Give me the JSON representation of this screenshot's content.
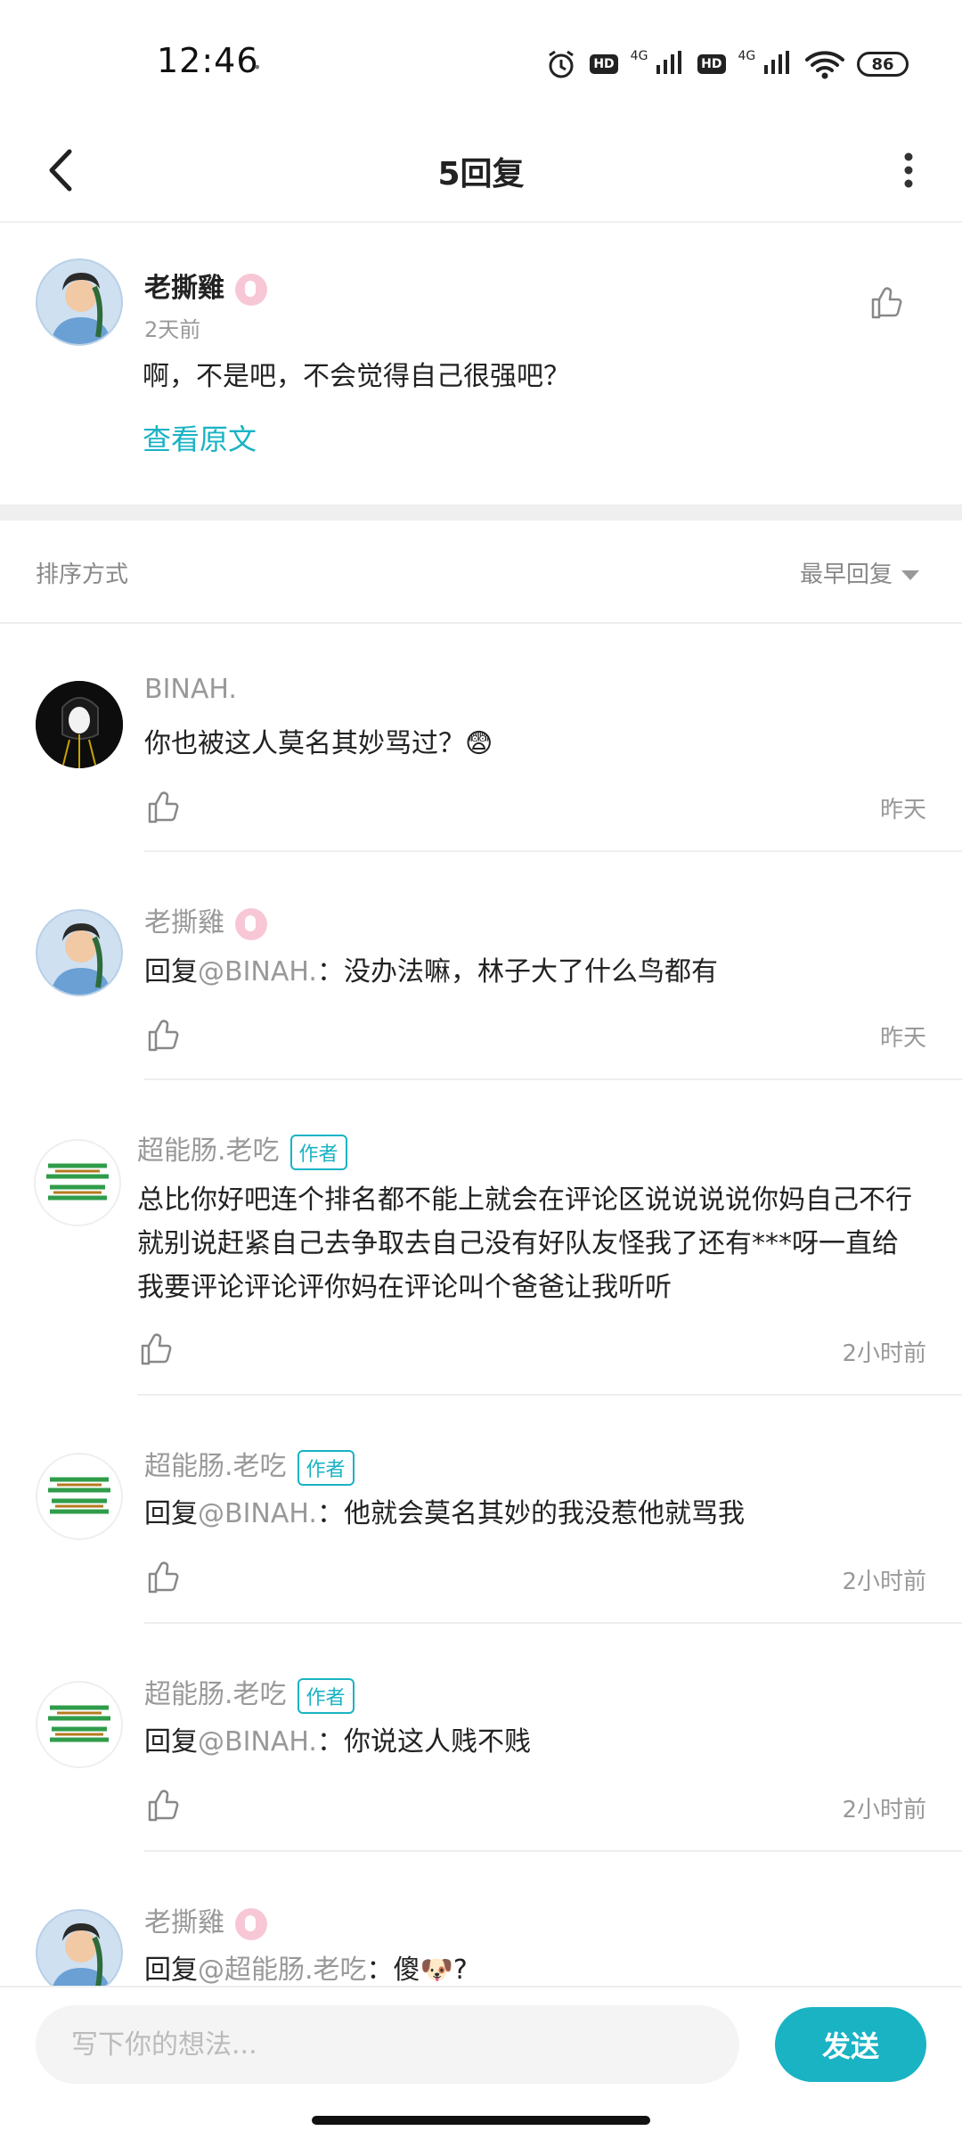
{
  "status": {
    "time": "12:46",
    "battery": "86",
    "hd": "HD",
    "net": "4G"
  },
  "header": {
    "title": "5回复"
  },
  "main_comment": {
    "user": "老撕雞",
    "time": "2天前",
    "text": "啊，不是吧，不会觉得自己很强吧？",
    "view_original": "查看原文"
  },
  "sort": {
    "label": "排序方式",
    "value": "最早回复"
  },
  "replies": [
    {
      "user": "BINAH.",
      "author": "",
      "prefix": "",
      "mention": "",
      "text": "你也被这人莫名其妙骂过？😨",
      "time": "昨天"
    },
    {
      "user": "老撕雞",
      "author": "",
      "prefix": "回复",
      "mention": "@BINAH.",
      "text": "：没办法嘛，林子大了什么鸟都有",
      "time": "昨天"
    },
    {
      "user": "超能肠.老吃",
      "author": "作者",
      "prefix": "",
      "mention": "",
      "text": "总比你好吧连个排名都不能上就会在评论区说说说说你妈自己不行就别说赶紧自己去争取去自己没有好队友怪我了还有***呀一直给我要评论评论评你妈在评论叫个爸爸让我听听",
      "time": "2小时前"
    },
    {
      "user": "超能肠.老吃",
      "author": "作者",
      "prefix": "回复",
      "mention": "@BINAH.",
      "text": "：他就会莫名其妙的我没惹他就骂我",
      "time": "2小时前"
    },
    {
      "user": "超能肠.老吃",
      "author": "作者",
      "prefix": "回复",
      "mention": "@BINAH.",
      "text": "：你说这人贱不贱",
      "time": "2小时前"
    },
    {
      "user": "老撕雞",
      "author": "",
      "prefix": "回复",
      "mention": "@超能肠.老吃",
      "text": "：傻🐶?",
      "time": ""
    }
  ],
  "input": {
    "placeholder": "写下你的想法...",
    "send": "发送"
  },
  "colors": {
    "accent": "#19b3c4",
    "pink_badge": "#f7c7d6"
  }
}
